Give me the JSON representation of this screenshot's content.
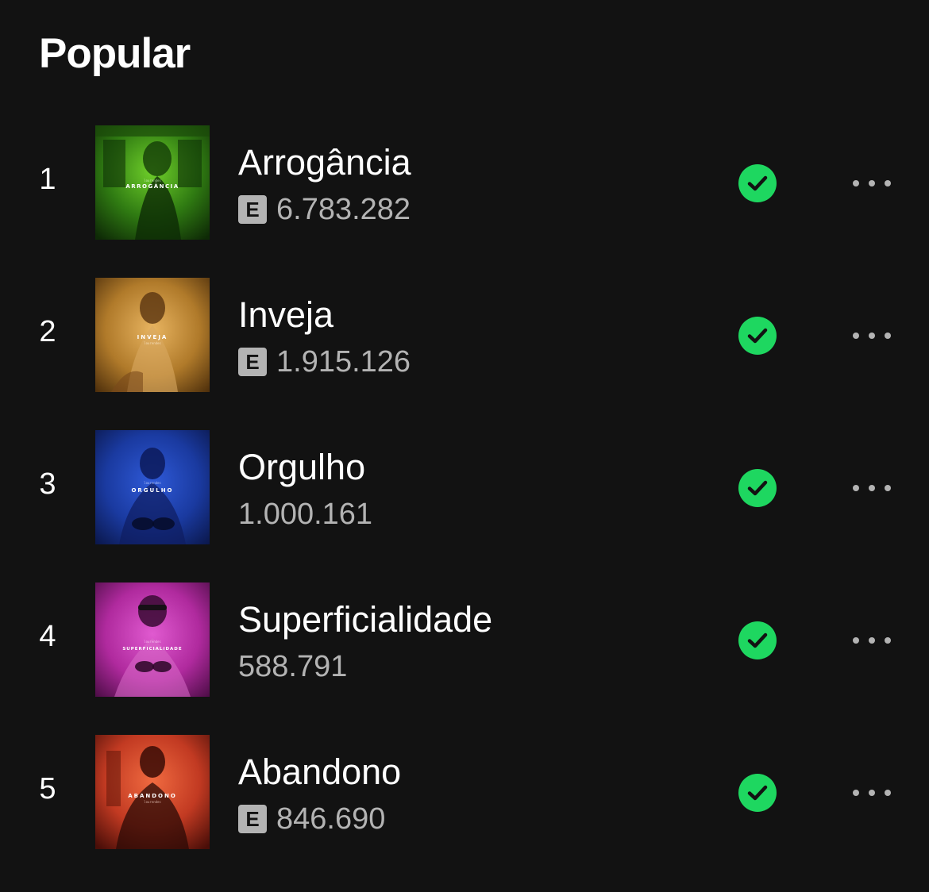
{
  "section": {
    "title": "Popular"
  },
  "colors": {
    "background": "#121212",
    "check_green": "#1ed760",
    "secondary_text": "#b3b3b3"
  },
  "tracks": [
    {
      "index": "1",
      "title": "Arrogância",
      "explicit": true,
      "explicit_label": "E",
      "plays": "6.783.282",
      "downloaded": true,
      "cover_text": "ARROGÂNCIA",
      "cover_artist": "lourendes",
      "cover_color": "#2f7a12"
    },
    {
      "index": "2",
      "title": "Inveja",
      "explicit": true,
      "explicit_label": "E",
      "plays": "1.915.126",
      "downloaded": true,
      "cover_text": "INVEJA",
      "cover_artist": "lourendes",
      "cover_color": "#b07a2a"
    },
    {
      "index": "3",
      "title": "Orgulho",
      "explicit": false,
      "explicit_label": "",
      "plays": "1.000.161",
      "downloaded": true,
      "cover_text": "ORGULHO",
      "cover_artist": "lourendes",
      "cover_color": "#1a3aa0"
    },
    {
      "index": "4",
      "title": "Superficialidade",
      "explicit": false,
      "explicit_label": "",
      "plays": "588.791",
      "downloaded": true,
      "cover_text": "SUPERFICIALIDADE",
      "cover_artist": "lourendes",
      "cover_color": "#b02a9e"
    },
    {
      "index": "5",
      "title": "Abandono",
      "explicit": true,
      "explicit_label": "E",
      "plays": "846.690",
      "downloaded": true,
      "cover_text": "ABANDONO",
      "cover_artist": "lourendes",
      "cover_color": "#c23a22"
    }
  ]
}
